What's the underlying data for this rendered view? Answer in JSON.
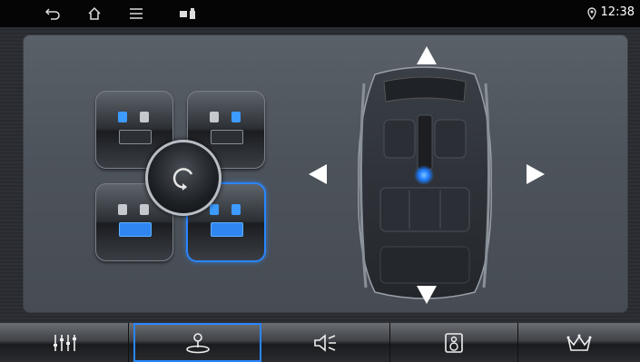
{
  "status_bar": {
    "time": "12:38",
    "icons": [
      "back-icon",
      "home-icon",
      "menu-icon",
      "sd-card-icon",
      "usb-icon",
      "location-icon"
    ]
  },
  "seat_selector": {
    "tiles": [
      {
        "position": "front-left",
        "active": false
      },
      {
        "position": "front-right",
        "active": false
      },
      {
        "position": "rear-left",
        "active": false
      },
      {
        "position": "rear-right",
        "active": true
      }
    ],
    "center_icon": "reset-rotate-icon"
  },
  "balance_pad": {
    "arrows": [
      "up-arrow-icon",
      "down-arrow-icon",
      "left-arrow-icon",
      "right-arrow-icon"
    ],
    "focus_marker_color": "#1e7bff"
  },
  "tabs": [
    {
      "icon": "equalizer-icon",
      "active": false
    },
    {
      "icon": "joystick-balance-icon",
      "active": true
    },
    {
      "icon": "speaker-volume-icon",
      "active": false
    },
    {
      "icon": "subwoofer-icon",
      "active": false
    },
    {
      "icon": "crown-icon",
      "active": false
    }
  ],
  "colors": {
    "accent": "#2a86ff",
    "panel": "#52575f"
  }
}
